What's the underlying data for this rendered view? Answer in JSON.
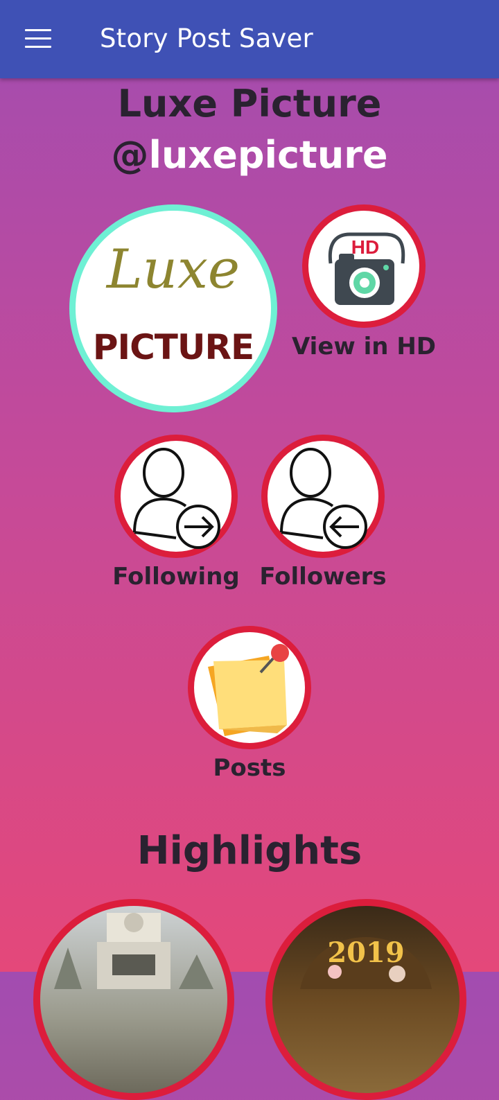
{
  "appbar": {
    "title": "Story Post Saver",
    "menu_icon": "hamburger-menu-icon"
  },
  "profile": {
    "name": "Luxe Picture",
    "handle_at": "@",
    "handle": "luxepicture",
    "avatar_script": "Luxe",
    "avatar_word": "PICTURE"
  },
  "actions": {
    "view_hd": "View in HD",
    "following": "Following",
    "followers": "Followers",
    "posts": "Posts"
  },
  "highlights": {
    "title": "Highlights",
    "items": [
      {
        "year": ""
      },
      {
        "year": "2019"
      }
    ]
  },
  "colors": {
    "appbar": "#3f51b5",
    "ring": "#dc1d3c",
    "avatar_ring": "#6ff0d4",
    "text_dark": "#2a2230"
  }
}
